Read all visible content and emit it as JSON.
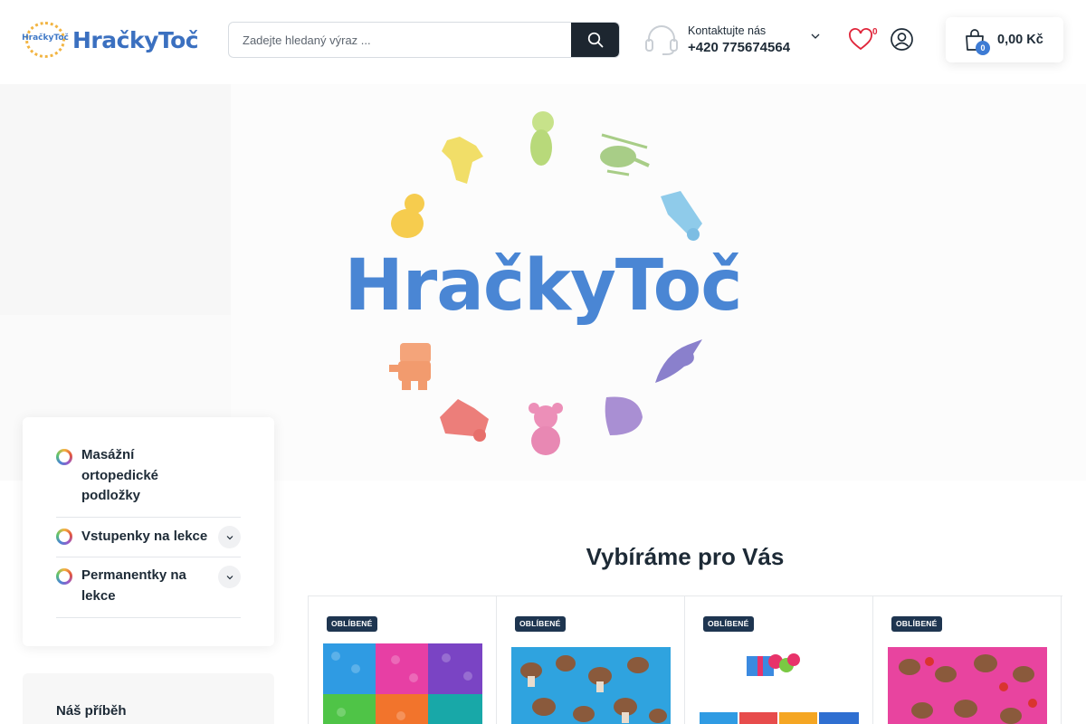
{
  "header": {
    "logo_badge_text": "HračkyToč",
    "logo_text": "HračkyToč",
    "search": {
      "placeholder": "Zadejte hledaný výraz ..."
    },
    "contact": {
      "label": "Kontaktujte nás",
      "phone": "+420 775674564"
    },
    "wishlist_count": "0",
    "cart": {
      "count": "0",
      "total": "0,00 Kč"
    }
  },
  "hero": {
    "brand": "HračkyToč"
  },
  "sidebar": {
    "categories": [
      {
        "label": "Masážní ortopedické podložky",
        "expandable": false
      },
      {
        "label": "Vstupenky na lekce",
        "expandable": true
      },
      {
        "label": "Permanentky na lekce",
        "expandable": true
      }
    ],
    "story_title": "Náš příběh"
  },
  "products_section": {
    "title": "Vybíráme pro Vás",
    "items": [
      {
        "badge": "OBLÍBENÉ",
        "image": "multicolor-mat-tiles"
      },
      {
        "badge": "OBLÍBENÉ",
        "image": "mushroom-mat-blue"
      },
      {
        "badge": "OBLÍBENÉ",
        "image": "gift-set-mats"
      },
      {
        "badge": "OBLÍBENÉ",
        "image": "mushroom-mat-pink"
      }
    ]
  },
  "colors": {
    "accent": "#3d7bd4",
    "dark": "#1d2630",
    "badge": "#1e3550",
    "wishlist": "#e0253a"
  }
}
